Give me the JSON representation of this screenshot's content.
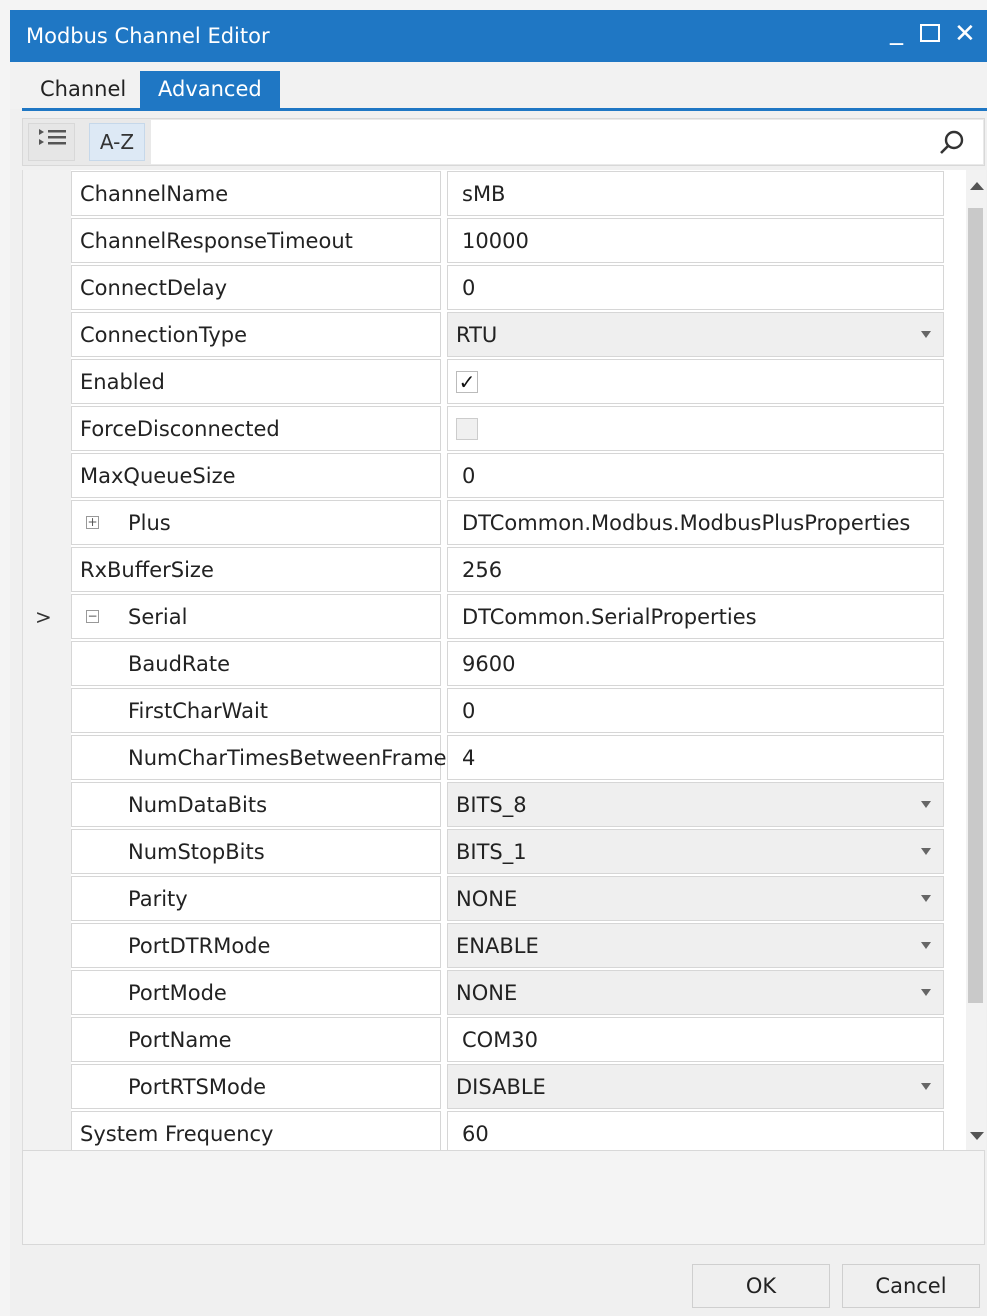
{
  "window": {
    "title": "Modbus Channel Editor",
    "controls": {
      "minimize": "_",
      "close": "✕"
    }
  },
  "tabs": [
    {
      "label": "Channel",
      "active": false
    },
    {
      "label": "Advanced",
      "active": true
    }
  ],
  "toolbar": {
    "categorized_icon": "categorized-list-icon",
    "az_label": "A-Z",
    "search_placeholder": ""
  },
  "properties": [
    {
      "name": "ChannelName",
      "value": "sMB",
      "type": "text"
    },
    {
      "name": "ChannelResponseTimeout",
      "value": "10000",
      "type": "text"
    },
    {
      "name": "ConnectDelay",
      "value": "0",
      "type": "text"
    },
    {
      "name": "ConnectionType",
      "value": "RTU",
      "type": "dropdown"
    },
    {
      "name": "Enabled",
      "value": "✓",
      "type": "checkbox-checked"
    },
    {
      "name": "ForceDisconnected",
      "value": "",
      "type": "checkbox-unchecked"
    },
    {
      "name": "MaxQueueSize",
      "value": "0",
      "type": "text"
    },
    {
      "name": "Plus",
      "value": "DTCommon.Modbus.ModbusPlusProperties",
      "type": "group-collapsed",
      "expander": "+"
    },
    {
      "name": "RxBufferSize",
      "value": "256",
      "type": "text"
    },
    {
      "name": "Serial",
      "value": "DTCommon.SerialProperties",
      "type": "group-expanded",
      "expander": "−",
      "selected": ">"
    },
    {
      "name": "BaudRate",
      "value": "9600",
      "type": "text",
      "child": true
    },
    {
      "name": "FirstCharWait",
      "value": "0",
      "type": "text",
      "child": true
    },
    {
      "name": "NumCharTimesBetweenFrames",
      "value": "4",
      "type": "text",
      "child": true
    },
    {
      "name": "NumDataBits",
      "value": "BITS_8",
      "type": "dropdown",
      "child": true
    },
    {
      "name": "NumStopBits",
      "value": "BITS_1",
      "type": "dropdown",
      "child": true
    },
    {
      "name": "Parity",
      "value": "NONE",
      "type": "dropdown",
      "child": true
    },
    {
      "name": "PortDTRMode",
      "value": "ENABLE",
      "type": "dropdown",
      "child": true
    },
    {
      "name": "PortMode",
      "value": "NONE",
      "type": "dropdown",
      "child": true
    },
    {
      "name": "PortName",
      "value": "COM30",
      "type": "text",
      "child": true
    },
    {
      "name": "PortRTSMode",
      "value": "DISABLE",
      "type": "dropdown",
      "child": true
    },
    {
      "name": "System Frequency",
      "value": "60",
      "type": "text"
    }
  ],
  "buttons": {
    "ok": "OK",
    "cancel": "Cancel"
  },
  "colors": {
    "accent": "#1f77c4"
  }
}
